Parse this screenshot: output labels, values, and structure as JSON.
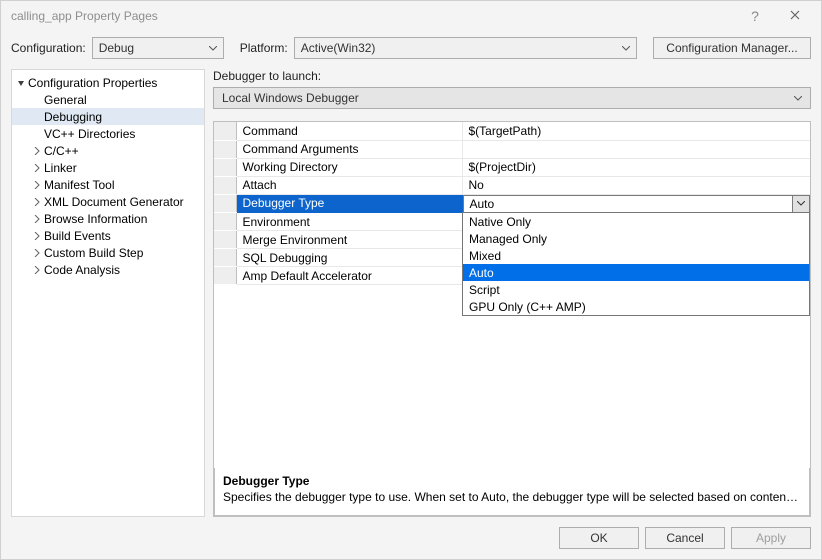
{
  "window": {
    "title": "calling_app Property Pages"
  },
  "config_row": {
    "config_label": "Configuration:",
    "config_value": "Debug",
    "platform_label": "Platform:",
    "platform_value": "Active(Win32)",
    "manager_button": "Configuration Manager..."
  },
  "tree": {
    "root_label": "Configuration Properties",
    "items": [
      {
        "label": "General",
        "depth": 1,
        "arrow": "none",
        "selected": false
      },
      {
        "label": "Debugging",
        "depth": 1,
        "arrow": "none",
        "selected": true
      },
      {
        "label": "VC++ Directories",
        "depth": 1,
        "arrow": "none",
        "selected": false
      },
      {
        "label": "C/C++",
        "depth": 1,
        "arrow": "right",
        "selected": false
      },
      {
        "label": "Linker",
        "depth": 1,
        "arrow": "right",
        "selected": false
      },
      {
        "label": "Manifest Tool",
        "depth": 1,
        "arrow": "right",
        "selected": false
      },
      {
        "label": "XML Document Generator",
        "depth": 1,
        "arrow": "right",
        "selected": false
      },
      {
        "label": "Browse Information",
        "depth": 1,
        "arrow": "right",
        "selected": false
      },
      {
        "label": "Build Events",
        "depth": 1,
        "arrow": "right",
        "selected": false
      },
      {
        "label": "Custom Build Step",
        "depth": 1,
        "arrow": "right",
        "selected": false
      },
      {
        "label": "Code Analysis",
        "depth": 1,
        "arrow": "right",
        "selected": false
      }
    ]
  },
  "launcher": {
    "label": "Debugger to launch:",
    "value": "Local Windows Debugger"
  },
  "grid": [
    {
      "name": "Command",
      "value": "$(TargetPath)",
      "selected": false
    },
    {
      "name": "Command Arguments",
      "value": "",
      "selected": false
    },
    {
      "name": "Working Directory",
      "value": "$(ProjectDir)",
      "selected": false
    },
    {
      "name": "Attach",
      "value": "No",
      "selected": false
    },
    {
      "name": "Debugger Type",
      "value": "Auto",
      "selected": true
    },
    {
      "name": "Environment",
      "value": "",
      "selected": false
    },
    {
      "name": "Merge Environment",
      "value": "",
      "selected": false
    },
    {
      "name": "SQL Debugging",
      "value": "",
      "selected": false
    },
    {
      "name": "Amp Default Accelerator",
      "value": "",
      "selected": false
    }
  ],
  "dropdown": {
    "items": [
      {
        "label": "Native Only",
        "selected": false
      },
      {
        "label": "Managed Only",
        "selected": false
      },
      {
        "label": "Mixed",
        "selected": false
      },
      {
        "label": "Auto",
        "selected": true
      },
      {
        "label": "Script",
        "selected": false
      },
      {
        "label": "GPU Only (C++ AMP)",
        "selected": false
      }
    ]
  },
  "description": {
    "title": "Debugger Type",
    "body": "Specifies the debugger type to use. When set to Auto, the debugger type will be selected based on contents of..."
  },
  "buttons": {
    "ok": "OK",
    "cancel": "Cancel",
    "apply": "Apply"
  }
}
